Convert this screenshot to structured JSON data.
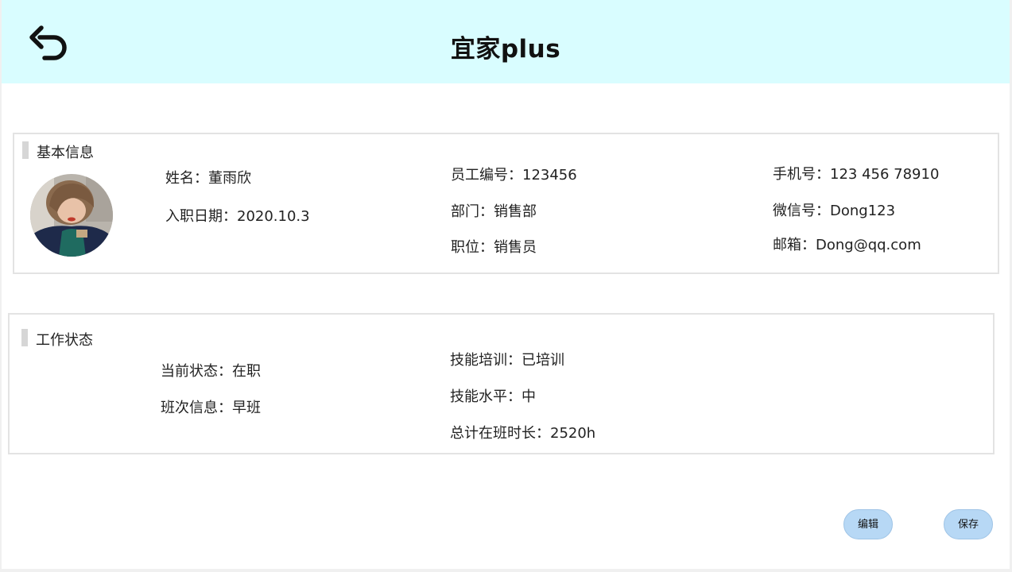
{
  "header": {
    "title": "宜家plus",
    "back_icon": "undo-arrow-icon"
  },
  "basic_info": {
    "section_title": "基本信息",
    "name": "姓名：董雨欣",
    "hire_date": "入职日期：2020.10.3",
    "employee_id": "员工编号：123456",
    "department": "部门：销售部",
    "position": "职位：销售员",
    "phone": "手机号：123 456 78910",
    "wechat": "微信号：Dong123",
    "email": "邮箱：Dong@qq.com"
  },
  "work_status": {
    "section_title": "工作状态",
    "current_status": "当前状态：在职",
    "shift_info": "班次信息：早班",
    "skill_training": "技能培训：已培训",
    "skill_level": "技能水平：中",
    "total_hours": "总计在班时长：2520h"
  },
  "actions": {
    "edit_label": "编辑",
    "save_label": "保存"
  },
  "colors": {
    "header_bg": "#d9fdff",
    "button_bg": "#b7d8f5",
    "card_border": "#e3e3e3"
  }
}
